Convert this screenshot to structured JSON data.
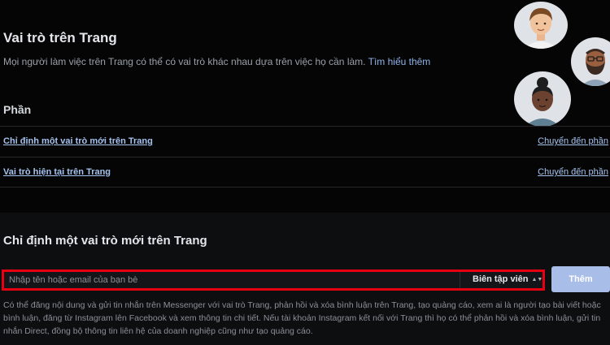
{
  "header": {
    "title": "Vai trò trên Trang",
    "subtitle": "Mọi người làm việc trên Trang có thể có vai trò khác nhau dựa trên việc họ cần làm.",
    "learn_more": "Tìm hiểu thêm"
  },
  "section": {
    "heading": "Phần",
    "rows": [
      {
        "label": "Chỉ định một vai trò mới trên Trang",
        "link": "Chuyển đến phần"
      },
      {
        "label": "Vai trò hiện tại trên Trang",
        "link": "Chuyển đến phần"
      }
    ]
  },
  "assign": {
    "heading": "Chỉ định một vai trò mới trên Trang",
    "input_placeholder": "Nhập tên hoặc email của bạn bè",
    "role_value": "Biên tập viên",
    "add_label": "Thêm",
    "description": "Có thể đăng nội dung và gửi tin nhắn trên Messenger với vai trò Trang, phản hồi và xóa bình luận trên Trang, tạo quảng cáo, xem ai là người tạo bài viết hoặc bình luận, đăng từ Instagram lên Facebook và xem thông tin chi tiết. Nếu tài khoản Instagram kết nối với Trang thì họ có thể phản hồi và xóa bình luận, gửi tin nhắn Direct, đồng bộ thông tin liên hệ của doanh nghiệp cũng như tạo quảng cáo."
  },
  "colors": {
    "highlight_border": "#e60012",
    "link": "#a5c3ef",
    "button": "#a8bde8"
  },
  "icons": [
    "avatar-man-icon",
    "avatar-bearded-man-icon",
    "avatar-woman-icon",
    "sort-caret-icon"
  ]
}
